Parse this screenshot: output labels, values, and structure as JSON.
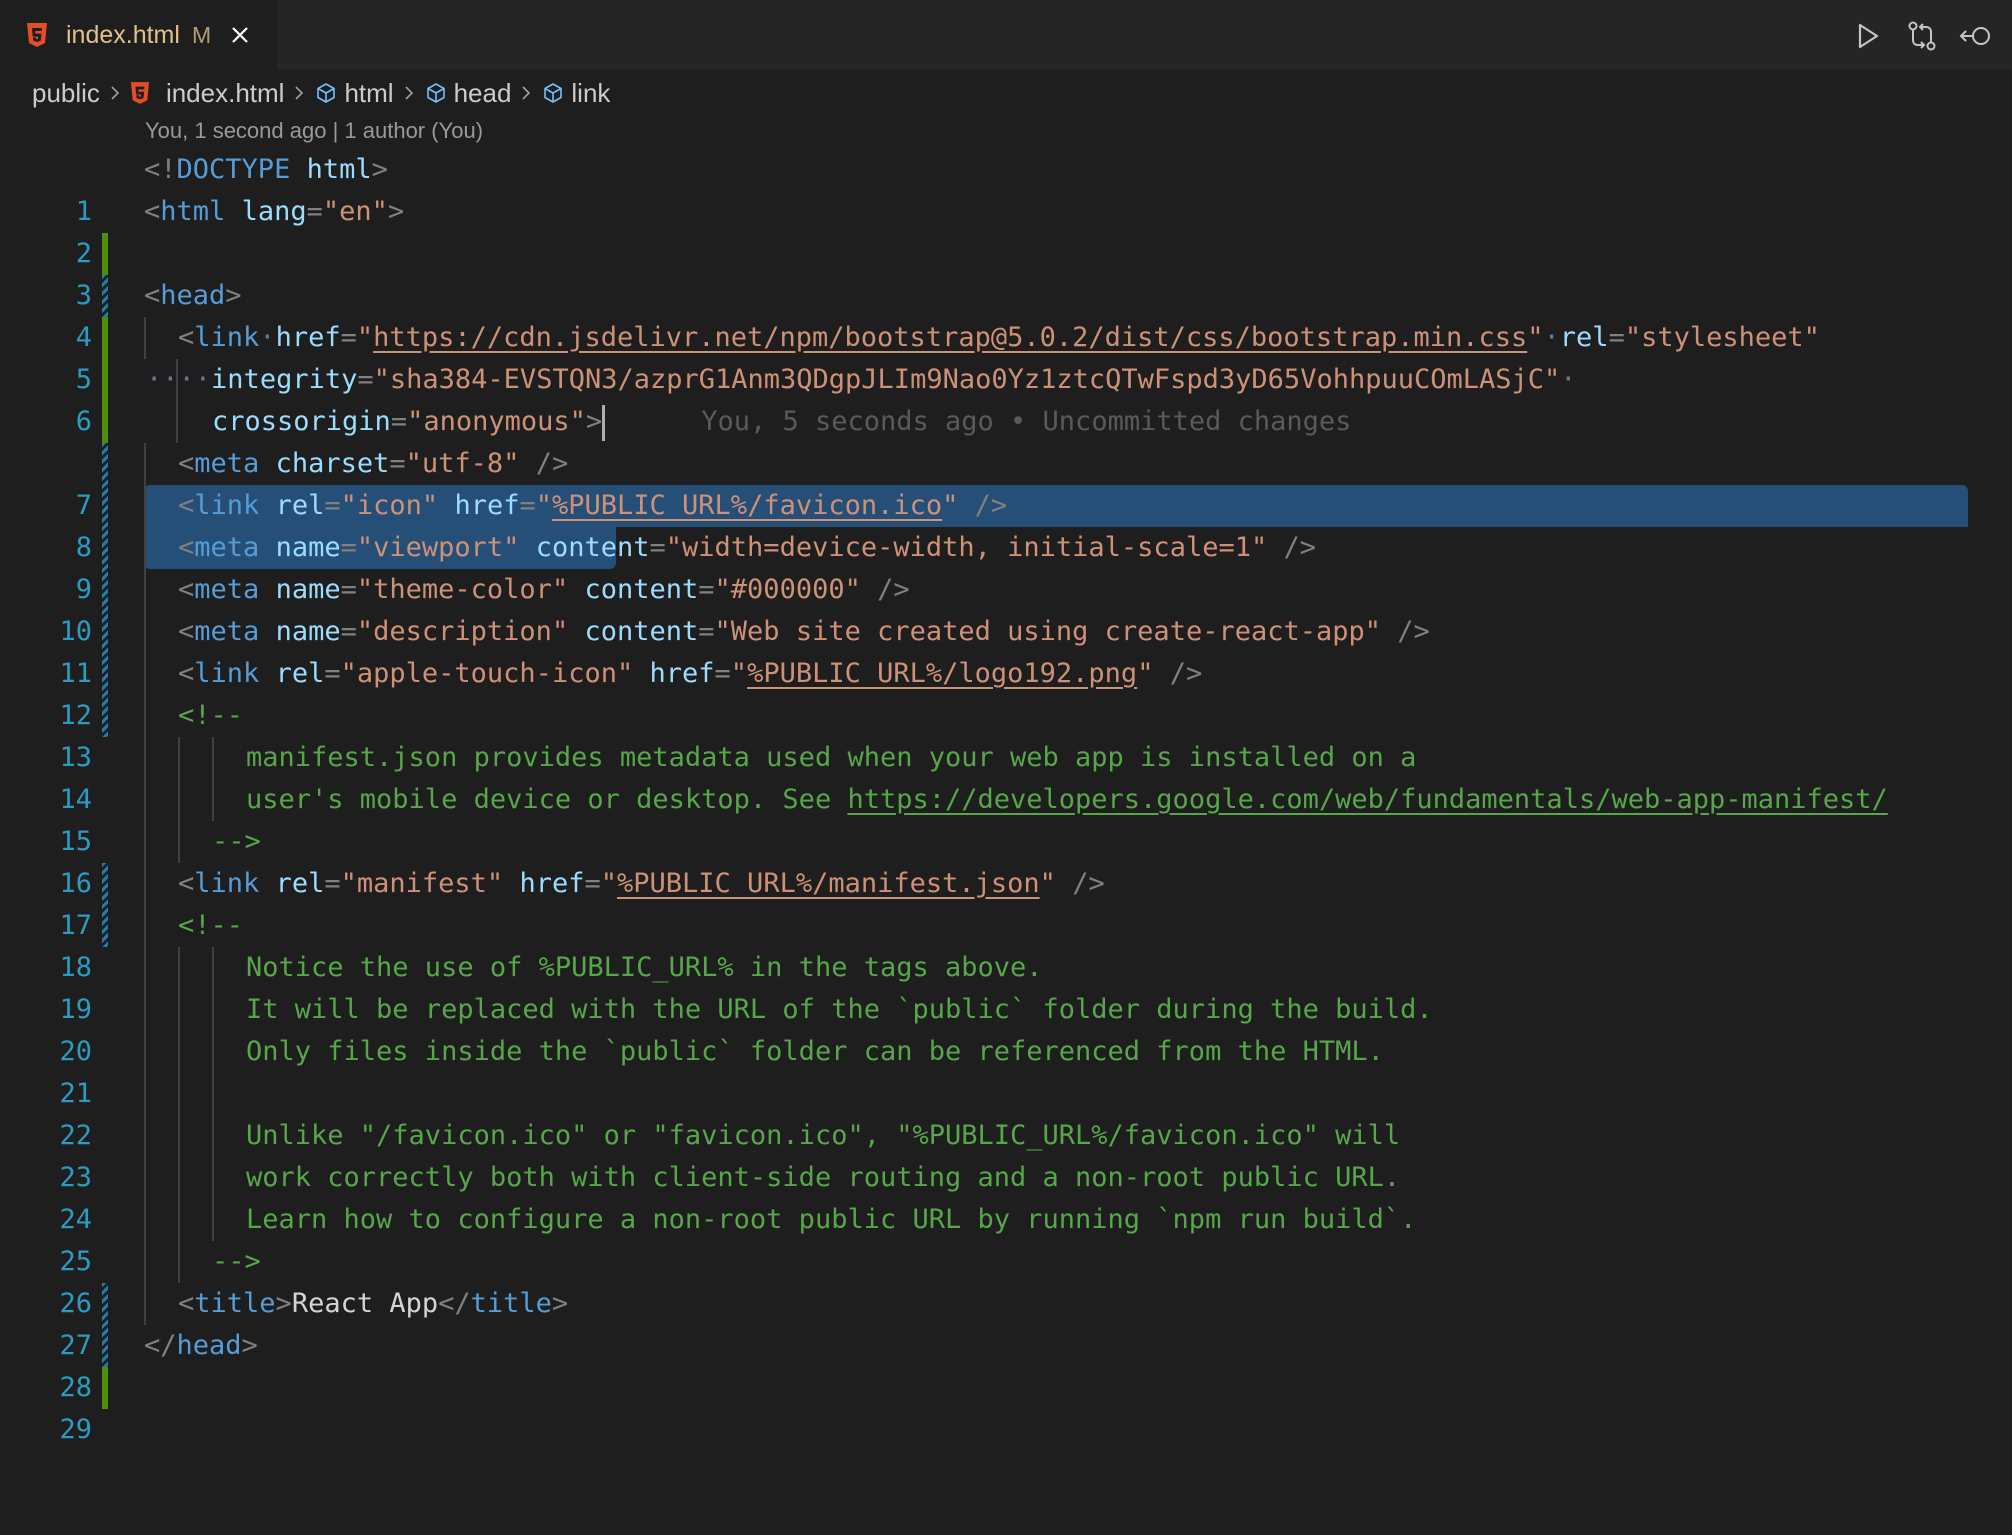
{
  "tab": {
    "file_name": "index.html",
    "status": "M",
    "icon": "html5-icon",
    "close_icon": "close-icon"
  },
  "editor_actions": [
    {
      "name": "run-button",
      "icon": "play-icon"
    },
    {
      "name": "open-changes-button",
      "icon": "git-compare-icon"
    },
    {
      "name": "timeline-button",
      "icon": "go-back-icon"
    }
  ],
  "breadcrumb": [
    {
      "label": "public",
      "icon": null
    },
    {
      "label": "index.html",
      "icon": "html5-icon"
    },
    {
      "label": "html",
      "icon": "symbol-element-icon"
    },
    {
      "label": "head",
      "icon": "symbol-element-icon"
    },
    {
      "label": "link",
      "icon": "symbol-element-icon"
    }
  ],
  "blame_header": "You, 1 second ago | 1 author (You)",
  "inline_blame": "You, 5 seconds ago • Uncommitted changes",
  "colors": {
    "accent_line_numbers": "#2b9cc1",
    "selection": "#264f78",
    "gutter_added": "#4e8f0a",
    "gutter_modified": "#1b81a8",
    "tab_modified": "#e2c08d"
  },
  "lines": [
    {
      "n": "1",
      "gutter": "none",
      "text": "<!DOCTYPE html>"
    },
    {
      "n": "2",
      "gutter": "none",
      "text": "<html lang=\"en\">"
    },
    {
      "n": "3",
      "gutter": "added",
      "text": ""
    },
    {
      "n": "4",
      "gutter": "mod",
      "text": "<head>"
    },
    {
      "n": "5",
      "gutter": "added",
      "text": "<link href=\"https://cdn.jsdelivr.net/npm/bootstrap@5.0.2/dist/css/bootstrap.min.css\" rel=\"stylesheet\""
    },
    {
      "n": "6",
      "gutter": "added",
      "text": "integrity=\"sha384-EVSTQN3/azprG1Anm3QDgpJLIm9Nao0Yz1ztcQTwFspd3yD65VohhpuuCOmLASjC\""
    },
    {
      "n": "",
      "gutter": "added",
      "text": "crossorigin=\"anonymous\">"
    },
    {
      "n": "7",
      "gutter": "mod",
      "text": "<meta charset=\"utf-8\" />"
    },
    {
      "n": "8",
      "gutter": "mod",
      "text": "<link rel=\"icon\" href=\"%PUBLIC_URL%/favicon.ico\" />"
    },
    {
      "n": "9",
      "gutter": "mod",
      "text": "<meta name=\"viewport\" content=\"width=device-width, initial-scale=1\" />"
    },
    {
      "n": "10",
      "gutter": "mod",
      "text": "<meta name=\"theme-color\" content=\"#000000\" />"
    },
    {
      "n": "11",
      "gutter": "mod",
      "text": "<meta name=\"description\" content=\"Web site created using create-react-app\" />"
    },
    {
      "n": "12",
      "gutter": "mod",
      "text": "<link rel=\"apple-touch-icon\" href=\"%PUBLIC_URL%/logo192.png\" />"
    },
    {
      "n": "13",
      "gutter": "mod",
      "text": "<!--"
    },
    {
      "n": "14",
      "gutter": "none",
      "text": "manifest.json provides metadata used when your web app is installed on a"
    },
    {
      "n": "15",
      "gutter": "none",
      "text": "user's mobile device or desktop. See https://developers.google.com/web/fundamentals/web-app-manifest/"
    },
    {
      "n": "16",
      "gutter": "none",
      "text": "-->"
    },
    {
      "n": "17",
      "gutter": "mod",
      "text": "<link rel=\"manifest\" href=\"%PUBLIC_URL%/manifest.json\" />"
    },
    {
      "n": "18",
      "gutter": "mod",
      "text": "<!--"
    },
    {
      "n": "19",
      "gutter": "none",
      "text": "Notice the use of %PUBLIC_URL% in the tags above."
    },
    {
      "n": "20",
      "gutter": "none",
      "text": "It will be replaced with the URL of the `public` folder during the build."
    },
    {
      "n": "21",
      "gutter": "none",
      "text": "Only files inside the `public` folder can be referenced from the HTML."
    },
    {
      "n": "22",
      "gutter": "none",
      "text": ""
    },
    {
      "n": "23",
      "gutter": "none",
      "text": "Unlike \"/favicon.ico\" or \"favicon.ico\", \"%PUBLIC_URL%/favicon.ico\" will"
    },
    {
      "n": "24",
      "gutter": "none",
      "text": "work correctly both with client-side routing and a non-root public URL."
    },
    {
      "n": "25",
      "gutter": "none",
      "text": "Learn how to configure a non-root public URL by running `npm run build`."
    },
    {
      "n": "26",
      "gutter": "none",
      "text": "-->"
    },
    {
      "n": "27",
      "gutter": "mod",
      "text": "<title>React App</title>"
    },
    {
      "n": "28",
      "gutter": "mod",
      "text": "</head>"
    },
    {
      "n": "29",
      "gutter": "added",
      "text": ""
    }
  ],
  "tokens": {
    "lt": "<",
    "gt": ">",
    "slash_gt": "/>",
    "eq": "=",
    "q": "\"",
    "bang": "!",
    "lt_slash": "</",
    "doctype": "DOCTYPE",
    "html": "html",
    "head": "head",
    "link": "link",
    "meta": "meta",
    "title": "title",
    "lang": "lang",
    "en": "en",
    "href": "href",
    "rel": "rel",
    "integrity": "integrity",
    "crossorigin": "crossorigin",
    "charset": "charset",
    "name": "name",
    "content": "content",
    "bootstrap_url": "https://cdn.jsdelivr.net/npm/bootstrap@5.0.2/dist/css/bootstrap.min.css",
    "stylesheet": "stylesheet",
    "sha": "sha384-EVSTQN3/azprG1Anm3QDgpJLIm9Nao0Yz1ztcQTwFspd3yD65VohhpuuCOmLASjC",
    "anonymous": "anonymous",
    "utf8": "utf-8",
    "icon": "icon",
    "favicon": "%PUBLIC_URL%/favicon.ico",
    "viewport": "viewport",
    "viewport_content": "width=device-width, initial-scale=1",
    "theme_color": "theme-color",
    "black": "#000000",
    "description": "description",
    "description_content": "Web site created using create-react-app",
    "apple_touch_icon": "apple-touch-icon",
    "logo192": "%PUBLIC_URL%/logo192.png",
    "comment_open": "<!--",
    "comment_close": "-->",
    "c14": "manifest.json provides metadata used when your web app is installed on a",
    "c15a": "user's mobile device or desktop. See ",
    "c15b": "https://developers.google.com/web/fundamentals/web-app-manifest/",
    "manifest": "manifest",
    "manifest_href": "%PUBLIC_URL%/manifest.json",
    "c19": "Notice the use of %PUBLIC_URL% in the tags above.",
    "c20": "It will be replaced with the URL of the `public` folder during the build.",
    "c21": "Only files inside the `public` folder can be referenced from the HTML.",
    "c23": "Unlike \"/favicon.ico\" or \"favicon.ico\", \"%PUBLIC_URL%/favicon.ico\" will",
    "c24": "work correctly both with client-side routing and a non-root public URL.",
    "c25": "Learn how to configure a non-root public URL by running `npm run build`.",
    "react_app": "React App",
    "ws_dot": "·",
    "ws_dots": "···"
  }
}
